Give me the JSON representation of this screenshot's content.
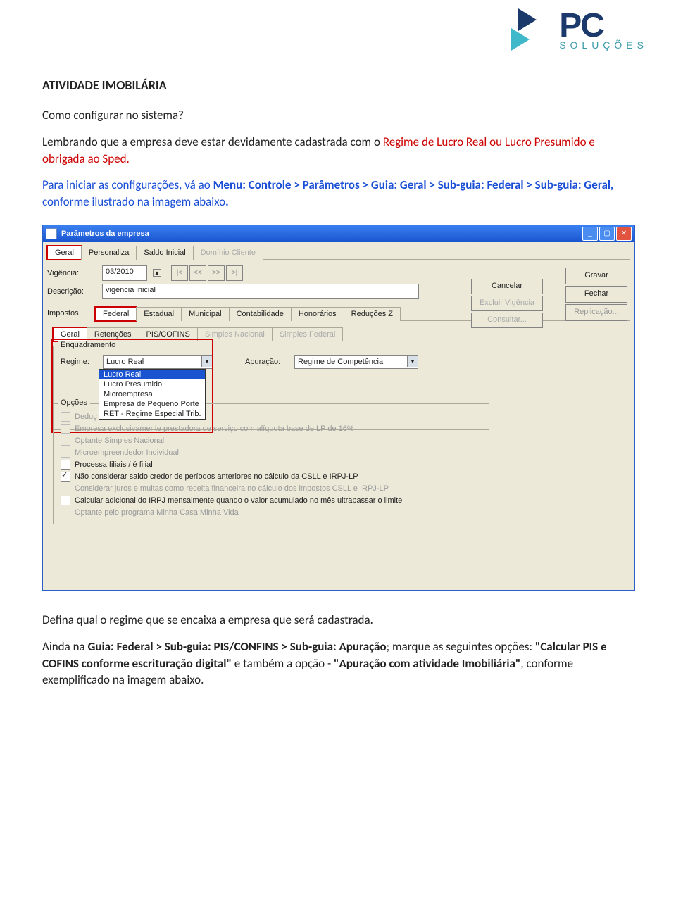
{
  "logo": {
    "top": "PC",
    "bottom": "SOLUÇÕES"
  },
  "doc": {
    "title": "ATIVIDADE IMOBILÁRIA",
    "subtitle": "Como configurar no sistema?",
    "p1a": "Lembrando que a empresa deve estar devidamente cadastrada com o ",
    "p1b": "Regime de Lucro Real ou Lucro Presumido e obrigada ao Sped.",
    "p2a": "Para iniciar as configurações, vá ao ",
    "p2b": "Menu: Controle > Parâmetros > Guia: Geral > Sub-guia: Federal > Sub-guia: Geral, ",
    "p2c": "conforme ilustrado na imagem abaixo",
    "p3": "Defina qual o regime que se encaixa a empresa que será cadastrada.",
    "p4a": "Ainda na ",
    "p4b": "Guia: Federal > Sub-guia: PIS/CONFINS  > Sub-guia: Apuração",
    "p4c": "; marque as seguintes opções:   ",
    "p4d": "\"Calcular PIS e COFINS conforme escrituração digital\"",
    "p4e": " e também  a opção -",
    "p4f": "\"Apuração com atividade Imobiliária\"",
    "p4g": ", conforme exemplificado na imagem abaixo."
  },
  "win": {
    "title": "Parâmetros da empresa",
    "tabs_top": [
      "Geral",
      "Personaliza",
      "Saldo Inicial",
      "Domínio Cliente"
    ],
    "vigencia_lbl": "Vigência:",
    "vigencia_val": "03/2010",
    "nav": [
      "|<",
      "<<",
      ">>",
      ">|"
    ],
    "desc_lbl": "Descrição:",
    "desc_val": "vigencia inicial",
    "impostos_lbl": "Impostos",
    "tabs_imp": [
      "Federal",
      "Estadual",
      "Municipal",
      "Contabilidade",
      "Honorários",
      "Reduções Z"
    ],
    "tabs_sub": [
      "Geral",
      "Retenções",
      "PIS/COFINS",
      "Simples Nacional",
      "Simples Federal"
    ],
    "sidebtns": [
      "Gravar",
      "Fechar",
      "Replicação..."
    ],
    "midbtns": [
      "Cancelar",
      "Excluir Vigência",
      "Consultar..."
    ],
    "enquadramento": "Enquadramento",
    "regime_lbl": "Regime:",
    "regime_val": "Lucro Real",
    "regime_opts": [
      "Lucro Real",
      "Lucro Presumido",
      "Microempresa",
      "Empresa de Pequeno Porte",
      "RET - Regime Especial Trib."
    ],
    "apuracao_lbl": "Apuração:",
    "apuracao_val": "Regime de Competência",
    "opcoes": "Opções",
    "checks": [
      {
        "t": "Deduç",
        "enabled": false
      },
      {
        "t": "Empresa exclusivamente prestadora de serviço com alíquota base de LP de 16%",
        "enabled": false
      },
      {
        "t": "Optante Simples Nacional",
        "enabled": false
      },
      {
        "t": "Microempreendedor Individual",
        "enabled": false
      },
      {
        "t": "Processa filiais / é filial",
        "enabled": true
      },
      {
        "t": "Não considerar saldo credor de períodos anteriores no cálculo da CSLL e IRPJ-LP",
        "enabled": true,
        "checked": true
      },
      {
        "t": "Considerar juros e multas como receita financeira no cálculo dos impostos CSLL e IRPJ-LP",
        "enabled": false
      },
      {
        "t": "Calcular adicional do IRPJ mensalmente quando o valor acumulado no mês ultrapassar o limite",
        "enabled": true
      },
      {
        "t": "Optante pelo programa Minha Casa Minha Vida",
        "enabled": false
      }
    ]
  }
}
